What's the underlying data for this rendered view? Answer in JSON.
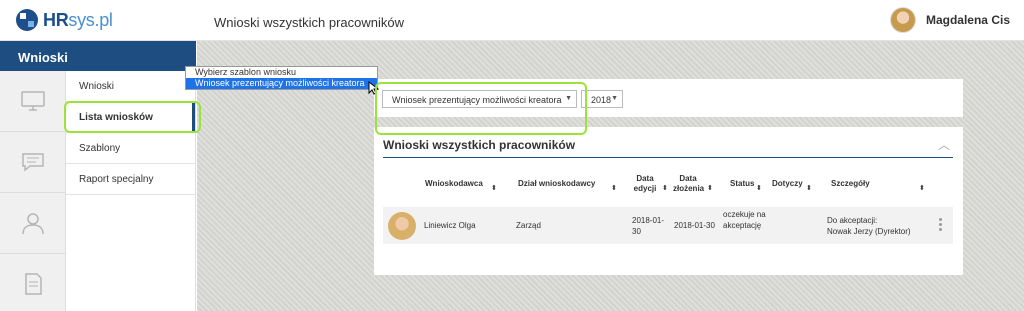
{
  "header": {
    "logo_bold": "HR",
    "logo_rest": "sys.pl",
    "page_title": "Wnioski wszystkich pracowników",
    "user_name": "Magdalena Cis"
  },
  "sidebar": {
    "module_title": "Wnioski",
    "icons": [
      "monitor-icon",
      "chat-icon",
      "user-icon",
      "document-icon"
    ],
    "items": [
      {
        "label": "Wnioski"
      },
      {
        "label": "Lista wniosków"
      },
      {
        "label": "Szablony"
      },
      {
        "label": "Raport specjalny"
      }
    ]
  },
  "filters": {
    "template_select": "Wniosek prezentujący możliwości kreatora",
    "year_select": "2018",
    "dropdown_options": [
      "Wybierz szablon wniosku",
      "Wniosek prezentujący możliwości kreatora"
    ]
  },
  "table": {
    "title": "Wnioski wszystkich pracowników",
    "headers": {
      "applicant": "Wnioskodawca",
      "department": "Dział wnioskodawcy",
      "edit_date": "Data edycji",
      "created_date": "Data złożenia",
      "status": "Status",
      "concerns": "Dotyczy",
      "details": "Szczegóły"
    },
    "rows": [
      {
        "applicant": "Liniewicz Olga",
        "department": "Zarząd",
        "edit_date": "2018-01-30",
        "created_date": "2018-01-30",
        "status": "oczekuje na akceptację",
        "concerns": "",
        "details_line1": "Do akceptacji:",
        "details_line2": "Nowak Jerzy (Dyrektor)"
      }
    ]
  },
  "colors": {
    "brand": "#1e4d82",
    "highlight": "#9be33a",
    "selected_option": "#1e73e8"
  }
}
